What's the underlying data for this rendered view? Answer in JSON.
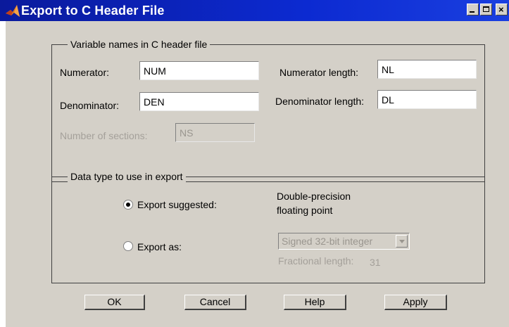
{
  "window": {
    "title": "Export to C Header File",
    "icon": "matlab-logo-icon",
    "title_bar_color": "#0c2ad1",
    "face_color": "#d4d0c8"
  },
  "variable_names": {
    "group_title": "Variable names in C header file",
    "numerator_label": "Numerator:",
    "numerator_value": "NUM",
    "numerator_length_label": "Numerator length:",
    "numerator_length_value": "NL",
    "denominator_label": "Denominator:",
    "denominator_value": "DEN",
    "denominator_length_label": "Denominator length:",
    "denominator_length_value": "DL",
    "sections_label": "Number of sections:",
    "sections_value": "NS"
  },
  "data_type": {
    "group_title": "Data type to use in export",
    "export_suggested_label": "Export suggested:",
    "export_suggested_selected": true,
    "suggested_type_line1": "Double-precision",
    "suggested_type_line2": "floating point",
    "export_as_label": "Export as:",
    "export_as_selected": false,
    "export_as_value": "Signed 32-bit integer",
    "fractional_length_label": "Fractional length:",
    "fractional_length_value": "31"
  },
  "buttons": {
    "ok": "OK",
    "cancel": "Cancel",
    "help": "Help",
    "apply": "Apply"
  }
}
